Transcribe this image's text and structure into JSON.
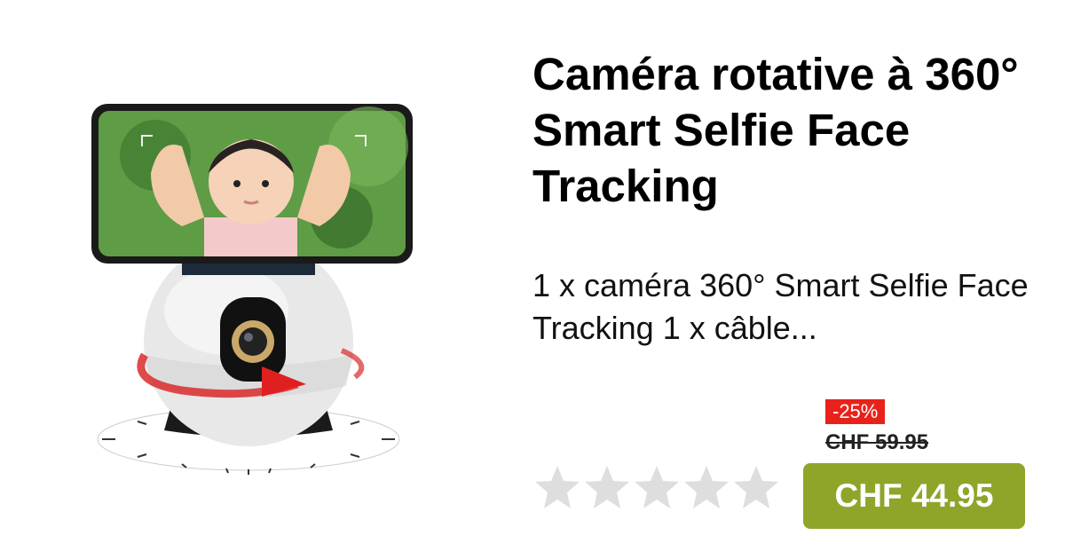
{
  "product": {
    "title": "Caméra rotative à 360° Smart Selfie Face Tracking",
    "description": "1 x caméra 360° Smart Selfie Face Tracking 1 x câble...",
    "discount": "-25%",
    "old_price": "CHF 59.95",
    "price": "CHF 44.95",
    "rating": {
      "filled": 0,
      "max": 5
    },
    "image": "360-selfie-tracking-camera-with-phone"
  },
  "colors": {
    "price_button": "#8ea52a",
    "discount_badge": "#e8221b",
    "star_empty": "#dedede"
  }
}
